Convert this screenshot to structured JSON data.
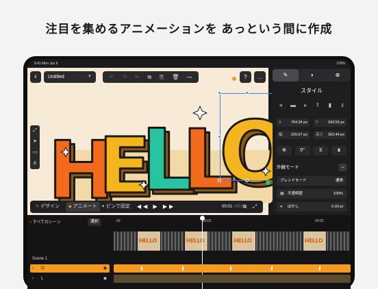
{
  "headline": "注目を集めるアニメーションを あっという間に作成",
  "status": {
    "time": "9:41",
    "date": "Mon Jun 6",
    "battery": "100%"
  },
  "topbar": {
    "back": "‹",
    "doc_title": "Untitled",
    "undo": "↶",
    "redo": "↷",
    "cut": "✂",
    "copy": "⧉",
    "paste": "⎘",
    "delete": "🗑",
    "edit_label": "Edit",
    "help": "?",
    "more": "…"
  },
  "canvas": {
    "text": "HELLO",
    "colors": {
      "h": "#f26a1b",
      "e": "#f4b51f",
      "l1": "#27c4a0",
      "l2": "#f26a1b",
      "o": "#f4b51f",
      "shadow": "#8f5a1a",
      "outline": "#1a1a1a"
    }
  },
  "tools": {
    "group": "⤢",
    "pointer": "➤",
    "rect": "▭",
    "anchor": "⚓"
  },
  "bottom_bar": {
    "design": "デザイン",
    "animate": "アニメート",
    "pin": "ピンで固定",
    "transport": "◀◀ ▶ ▶▶",
    "time_current": "00:01",
    "time_sep": "/",
    "time_total": "00:03",
    "icons": "⧉ ⤢"
  },
  "panel": {
    "tabs": [
      "✎",
      "◑",
      "⊕"
    ],
    "title": "スタイル",
    "align_icons": [
      "⫷",
      "▬",
      "⫸",
      "⫪",
      "▮",
      "⫫"
    ],
    "x_label": "X",
    "x_value": "764.34 px",
    "y_label": "Y",
    "y_value": "243.55 px",
    "w_label": "幅",
    "w_value": "220.67 px",
    "h_label": "高さ",
    "h_value": "363.44 px",
    "rot_icons": [
      "⊕",
      "0°",
      "⧖",
      "⧗"
    ],
    "appearance": "外観モード",
    "blend_label": "ブレンドモード",
    "blend_value": "通常",
    "opacity_label": "不透明度",
    "opacity_value": "100%",
    "blur_label": "ぼかし",
    "blur_value": "0.00 pt"
  },
  "timeline": {
    "all_scenes": "すべてのシーン",
    "select": "選択",
    "ruler": [
      "00",
      "00:01",
      "00:02"
    ],
    "scene_label": "Scene 1",
    "layer_o": "O",
    "layer_l": "L"
  }
}
